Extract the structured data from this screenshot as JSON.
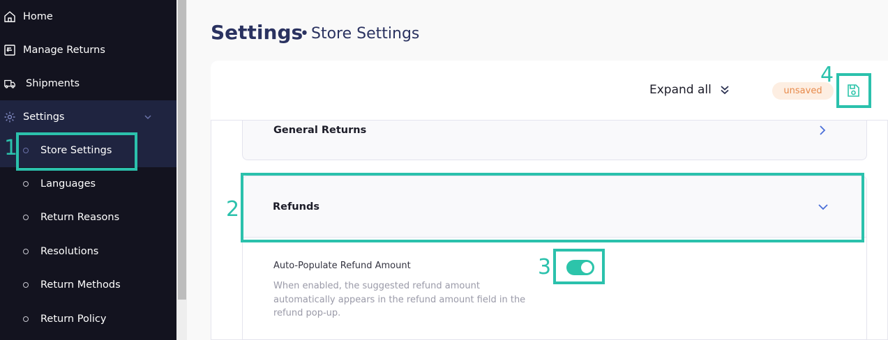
{
  "sidebar": {
    "items": [
      {
        "label": "Home",
        "icon": "home-icon"
      },
      {
        "label": "Manage Returns",
        "icon": "returns-box-icon"
      },
      {
        "label": "Shipments",
        "icon": "truck-icon"
      },
      {
        "label": "Settings",
        "icon": "gear-icon"
      }
    ],
    "sub_items": [
      {
        "label": "Store Settings",
        "active": true
      },
      {
        "label": "Languages"
      },
      {
        "label": "Return Reasons"
      },
      {
        "label": "Resolutions"
      },
      {
        "label": "Return Methods"
      },
      {
        "label": "Return Policy"
      }
    ]
  },
  "header": {
    "title": "Settings",
    "separator": "•",
    "subtitle": "Store Settings"
  },
  "toolbar": {
    "expand_label": "Expand all",
    "status_badge": "unsaved"
  },
  "sections": {
    "general": {
      "title": "General Returns"
    },
    "refunds": {
      "title": "Refunds",
      "setting_label": "Auto-Populate Refund Amount",
      "setting_desc": "When enabled, the suggested refund amount automatically appears in the refund amount field in the refund pop-up.",
      "toggle_on": true
    }
  },
  "annotations": [
    "1",
    "2",
    "3",
    "4"
  ],
  "colors": {
    "sidebar_bg": "#13131f",
    "sidebar_active": "#1f2440",
    "accent": "#2cc4aa",
    "annotation": "#2bc1ac",
    "title": "#2a3260",
    "badge_bg": "#fdeee2",
    "badge_text": "#e7894a"
  }
}
